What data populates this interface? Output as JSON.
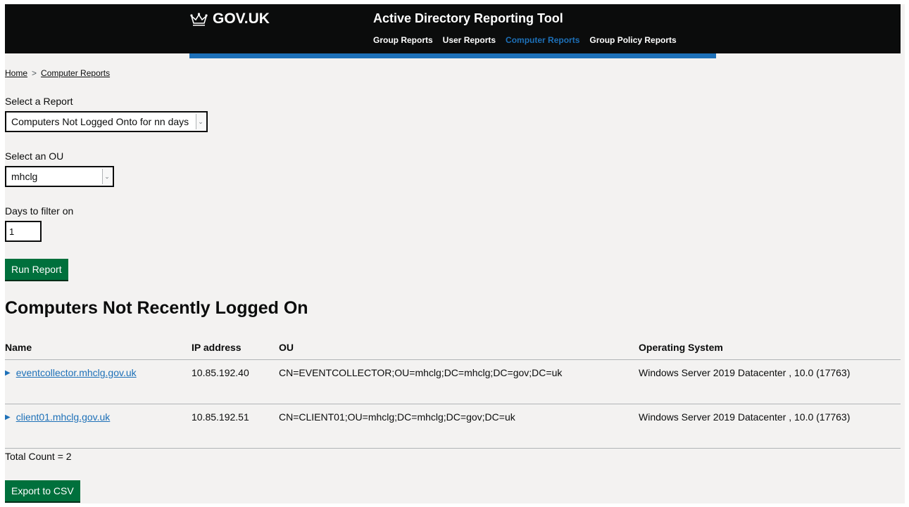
{
  "header": {
    "logo_text": "GOV.UK",
    "service_name": "Active Directory Reporting Tool",
    "nav": [
      {
        "label": "Group Reports",
        "active": false
      },
      {
        "label": "User Reports",
        "active": false
      },
      {
        "label": "Computer Reports",
        "active": true
      },
      {
        "label": "Group Policy Reports",
        "active": false
      }
    ]
  },
  "breadcrumb": {
    "home": "Home",
    "current": "Computer Reports",
    "separator": ">"
  },
  "form": {
    "report_label": "Select a Report",
    "report_value": "Computers Not Logged Onto for nn days",
    "ou_label": "Select an OU",
    "ou_value": "mhclg",
    "days_label": "Days to filter on",
    "days_value": "1",
    "run_button": "Run Report"
  },
  "results": {
    "title": "Computers Not Recently Logged On",
    "columns": [
      "Name",
      "IP address",
      "OU",
      "Operating System"
    ],
    "rows": [
      {
        "name": "eventcollector.mhclg.gov.uk",
        "ip": "10.85.192.40",
        "ou": "CN=EVENTCOLLECTOR;OU=mhclg;DC=mhclg;DC=gov;DC=uk",
        "os": "Windows Server 2019 Datacenter , 10.0 (17763)"
      },
      {
        "name": "client01.mhclg.gov.uk",
        "ip": "10.85.192.51",
        "ou": "CN=CLIENT01;OU=mhclg;DC=mhclg;DC=gov;DC=uk",
        "os": "Windows Server 2019 Datacenter , 10.0 (17763)"
      }
    ],
    "total": "Total Count = 2",
    "export_button": "Export to CSV"
  },
  "colors": {
    "header_bg": "#0b0c0c",
    "accent_blue": "#1d70b8",
    "button_green": "#00703c",
    "page_bg": "#f3f2f1"
  },
  "icons": [
    "crown-icon",
    "chevron-right-icon",
    "dropdown-arrow-icon",
    "expand-triangle-icon"
  ]
}
